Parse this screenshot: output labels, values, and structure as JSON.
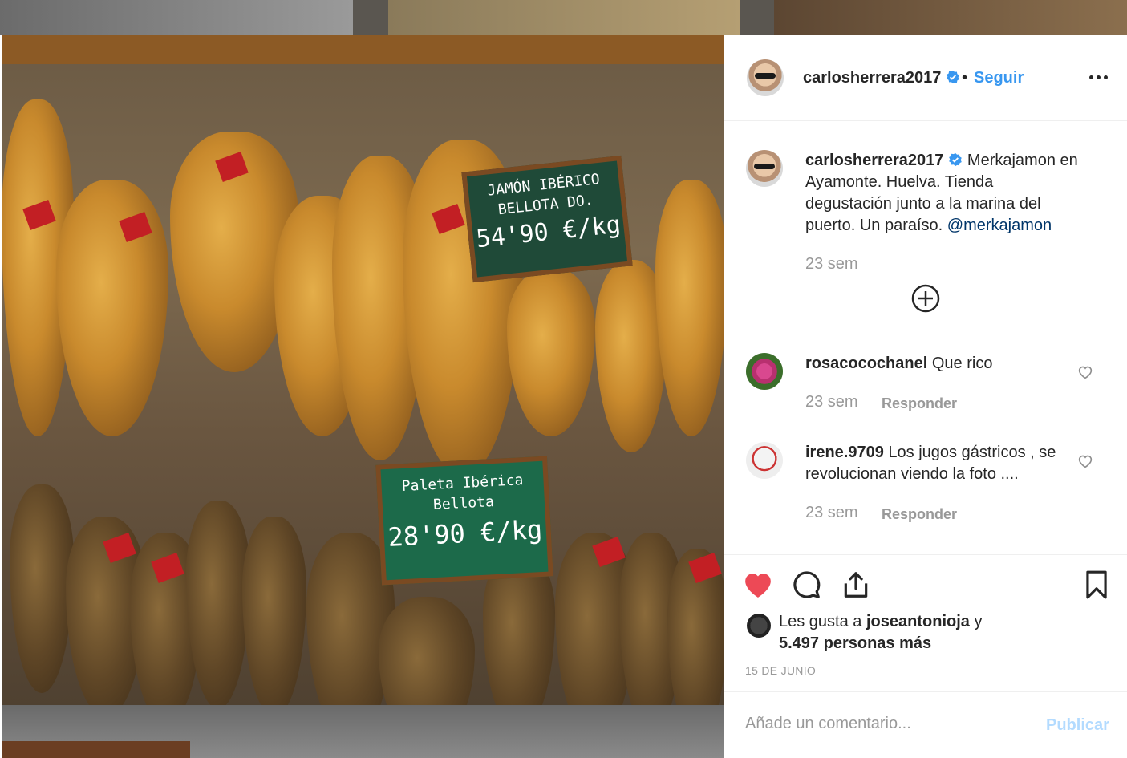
{
  "post": {
    "username": "carlosherrera2017",
    "follow_label": "Seguir",
    "separator": "•"
  },
  "caption": {
    "username": "carlosherrera2017",
    "text": "Merkajamon en Ayamonte. Huelva. Tienda degustación junto a la marina del puerto. Un paraíso.",
    "mention": "@merkajamon",
    "time": "23 sem"
  },
  "comments": [
    {
      "username": "rosacocochanel",
      "text": "Que rico",
      "time": "23 sem",
      "reply": "Responder"
    },
    {
      "username": "irene.9709",
      "text": "Los jugos gástricos , se revolucionan viendo la foto ....",
      "time": "23 sem",
      "reply": "Responder"
    }
  ],
  "likes": {
    "prefix": "Les gusta a",
    "user": "joseantonioja",
    "suffix": "y",
    "count_text": "5.497 personas más"
  },
  "date": "15 DE JUNIO",
  "add_comment": {
    "placeholder": "Añade un comentario...",
    "publish": "Publicar"
  },
  "photo_signs": {
    "sign1": [
      "JAMÓN IBÉRICO",
      "BELLOTA DO.",
      "54'90 €/kg"
    ],
    "sign2": [
      "Paleta Ibérica",
      "Bellota",
      "28'90 €/kg"
    ]
  },
  "colors": {
    "link": "#3897f0",
    "like_red": "#ed4956",
    "muted": "#999999",
    "publish_disabled": "#b3dbff"
  }
}
